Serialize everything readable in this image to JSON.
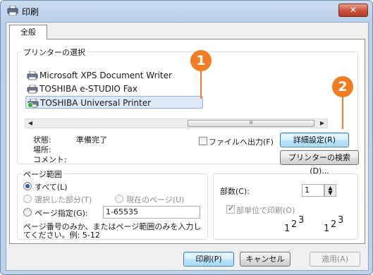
{
  "window": {
    "title": "印刷",
    "close_glyph": "✕"
  },
  "tab": {
    "label": "全般"
  },
  "printer_select": {
    "group_label": "プリンターの選択",
    "printers": [
      {
        "name": "Microsoft XPS Document Writer",
        "selected": false
      },
      {
        "name": "TOSHIBA e-STUDIO Fax",
        "selected": false
      },
      {
        "name": "TOSHIBA Universal Printer",
        "selected": true
      }
    ],
    "scroll_left": "◀",
    "scroll_right": "▶",
    "thumb_grip": "III"
  },
  "status": {
    "state_label": "状態:",
    "state_value": "準備完了",
    "location_label": "場所:",
    "comment_label": "コメント:"
  },
  "print_to_file": {
    "label": "ファイルへ出力(F)",
    "checked": false
  },
  "buttons": {
    "preferences": "詳細設定(R)",
    "find_printer": "プリンターの検索(D)...",
    "print": "印刷(P)",
    "cancel": "キャンセル",
    "apply": "適用(A)"
  },
  "page_range": {
    "group_label": "ページ範囲",
    "all": "すべて(L)",
    "selection": "選択した部分(T)",
    "current_page": "現在のページ(U)",
    "pages": "ページ指定(G):",
    "pages_value": "1-65535",
    "hint_line1": "ページ番号のみか、またはページ範囲のみを入力し",
    "hint_line2": "てください。例: 5-12"
  },
  "copies": {
    "label": "部数(C):",
    "value": "1",
    "collate_label": "部単位で印刷(O)",
    "collate_checked": true,
    "collate_pages": [
      "1",
      "2",
      "3"
    ]
  },
  "callouts": {
    "first": "1",
    "second": "2"
  },
  "colors": {
    "callout": "#f27c21"
  }
}
